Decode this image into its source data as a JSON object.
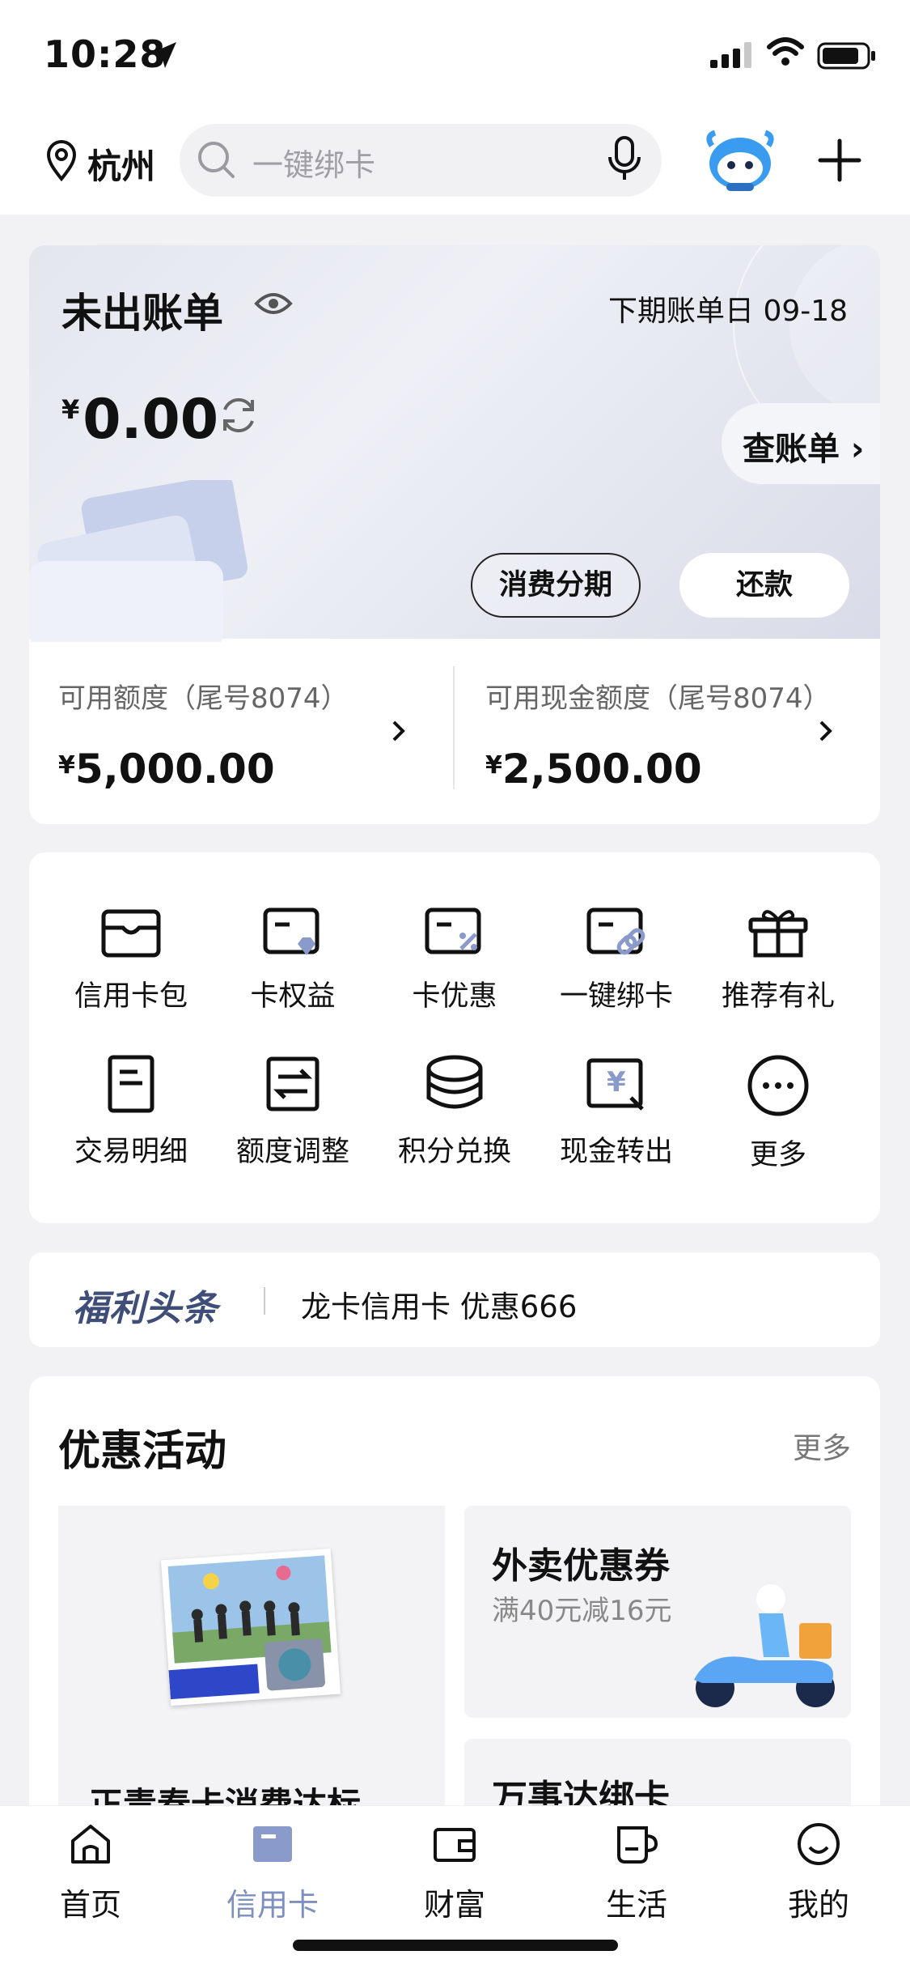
{
  "status_bar": {
    "time": "10:28"
  },
  "header": {
    "city": "杭州",
    "search_placeholder": "一键绑卡"
  },
  "bill": {
    "title": "未出账单",
    "next_bill_label": "下期账单日",
    "next_bill_date": "09-18",
    "currency": "¥",
    "amount": "0.00",
    "check_bill": "查账单",
    "installment_button": "消费分期",
    "repay_button": "还款"
  },
  "quota": {
    "available_label": "可用额度（尾号8074）",
    "available_value": "5,000.00",
    "cash_label": "可用现金额度（尾号8074）",
    "cash_value": "2,500.00"
  },
  "grid": {
    "items": [
      {
        "label": "信用卡包",
        "icon": "card-wallet-icon"
      },
      {
        "label": "卡权益",
        "icon": "card-rights-icon"
      },
      {
        "label": "卡优惠",
        "icon": "card-discount-icon"
      },
      {
        "label": "一键绑卡",
        "icon": "card-link-icon"
      },
      {
        "label": "推荐有礼",
        "icon": "gift-icon"
      },
      {
        "label": "交易明细",
        "icon": "document-icon"
      },
      {
        "label": "额度调整",
        "icon": "adjust-icon"
      },
      {
        "label": "积分兑换",
        "icon": "coins-icon"
      },
      {
        "label": "现金转出",
        "icon": "cash-out-icon"
      },
      {
        "label": "更多",
        "icon": "more-icon"
      }
    ]
  },
  "headline": {
    "tag": "福利头条",
    "text": "龙卡信用卡 优惠666"
  },
  "promos": {
    "title": "优惠活动",
    "more": "更多",
    "left_card_title": "正青春卡消费达标",
    "right_card_1_title": "外卖优惠券",
    "right_card_1_sub": "满40元减16元",
    "right_card_2_title": "万事达绑卡"
  },
  "tabbar": {
    "tabs": [
      {
        "label": "首页",
        "icon": "home-icon"
      },
      {
        "label": "信用卡",
        "icon": "credit-card-icon",
        "active": true
      },
      {
        "label": "财富",
        "icon": "wallet-icon"
      },
      {
        "label": "生活",
        "icon": "cup-icon"
      },
      {
        "label": "我的",
        "icon": "smile-icon"
      }
    ]
  },
  "colors": {
    "accent_blue": "#7d8fbf",
    "headline_tag": "#3f4e79"
  }
}
